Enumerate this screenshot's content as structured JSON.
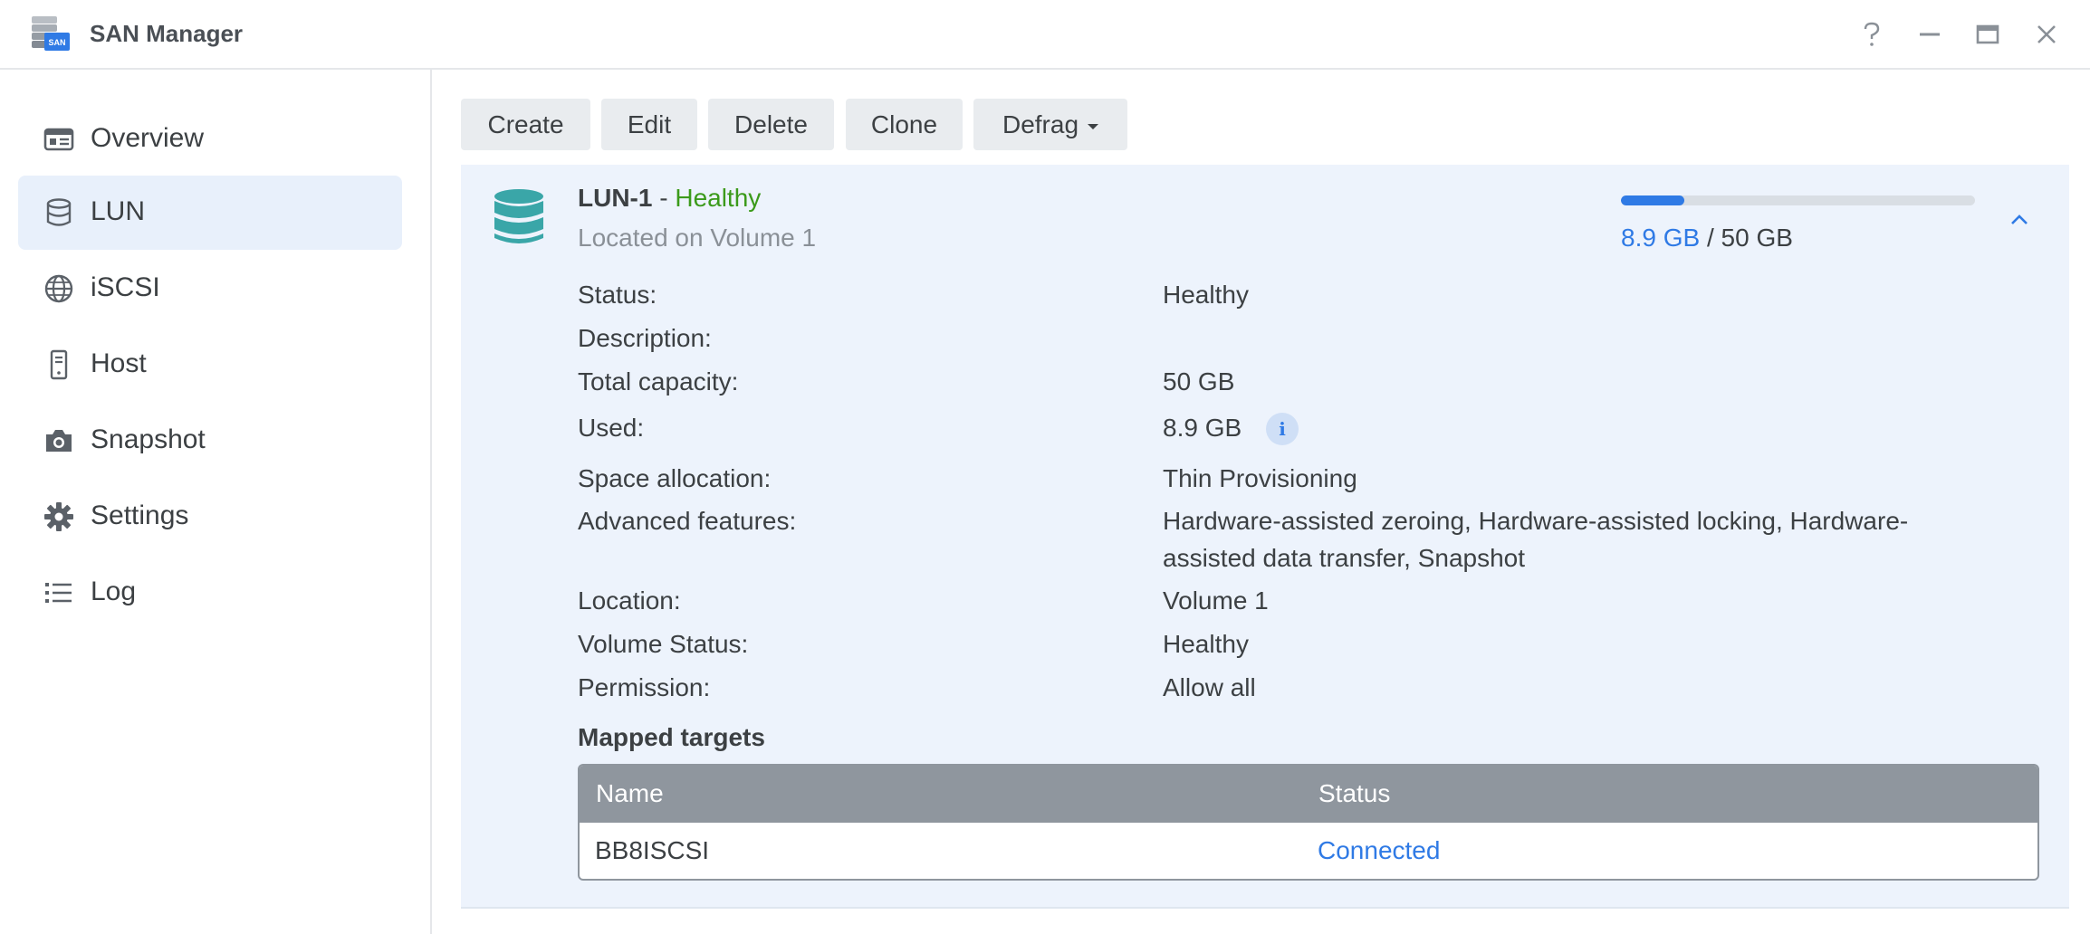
{
  "app": {
    "title": "SAN Manager",
    "icon": "san-manager-icon",
    "window_controls": [
      "help-icon",
      "minimize-icon",
      "maximize-icon",
      "close-icon"
    ]
  },
  "sidebar": {
    "items": [
      {
        "label": "Overview",
        "icon": "overview-icon",
        "active": false
      },
      {
        "label": "LUN",
        "icon": "database-icon",
        "active": true
      },
      {
        "label": "iSCSI",
        "icon": "globe-icon",
        "active": false
      },
      {
        "label": "Host",
        "icon": "server-icon",
        "active": false
      },
      {
        "label": "Snapshot",
        "icon": "camera-icon",
        "active": false
      },
      {
        "label": "Settings",
        "icon": "gear-icon",
        "active": false
      },
      {
        "label": "Log",
        "icon": "list-icon",
        "active": false
      }
    ]
  },
  "toolbar": {
    "create": "Create",
    "edit": "Edit",
    "delete": "Delete",
    "clone": "Clone",
    "defrag": "Defrag"
  },
  "lun": {
    "name": "LUN-1",
    "separator": "-",
    "health": "Healthy",
    "location_line": "Located on Volume 1",
    "usage": {
      "used": "8.9 GB",
      "separator": "/",
      "total": "50 GB",
      "used_fraction": 0.178
    },
    "properties": [
      {
        "label": "Status:",
        "value": "Healthy"
      },
      {
        "label": "Description:",
        "value": ""
      },
      {
        "label": "Total capacity:",
        "value": "50 GB"
      },
      {
        "label": "Used:",
        "value": "8.9 GB"
      },
      {
        "label": "Space allocation:",
        "value": "Thin Provisioning"
      },
      {
        "label": "Advanced features:",
        "value": "Hardware-assisted zeroing, Hardware-assisted locking, Hardware-assisted data transfer, Snapshot"
      },
      {
        "label": "Location:",
        "value": "Volume 1"
      },
      {
        "label": "Volume Status:",
        "value": "Healthy"
      },
      {
        "label": "Permission:",
        "value": "Allow all"
      }
    ],
    "info_badge": "i",
    "mapped_targets": {
      "title": "Mapped targets",
      "columns": [
        "Name",
        "Status"
      ],
      "rows": [
        {
          "name": "BB8ISCSI",
          "status": "Connected"
        }
      ]
    }
  },
  "colors": {
    "accent": "#2f7ae5",
    "healthy": "#3b9a1a",
    "active_nav_bg": "#e8f0fb",
    "panel_bg": "#edf3fc",
    "table_header_bg": "#8f969e"
  }
}
